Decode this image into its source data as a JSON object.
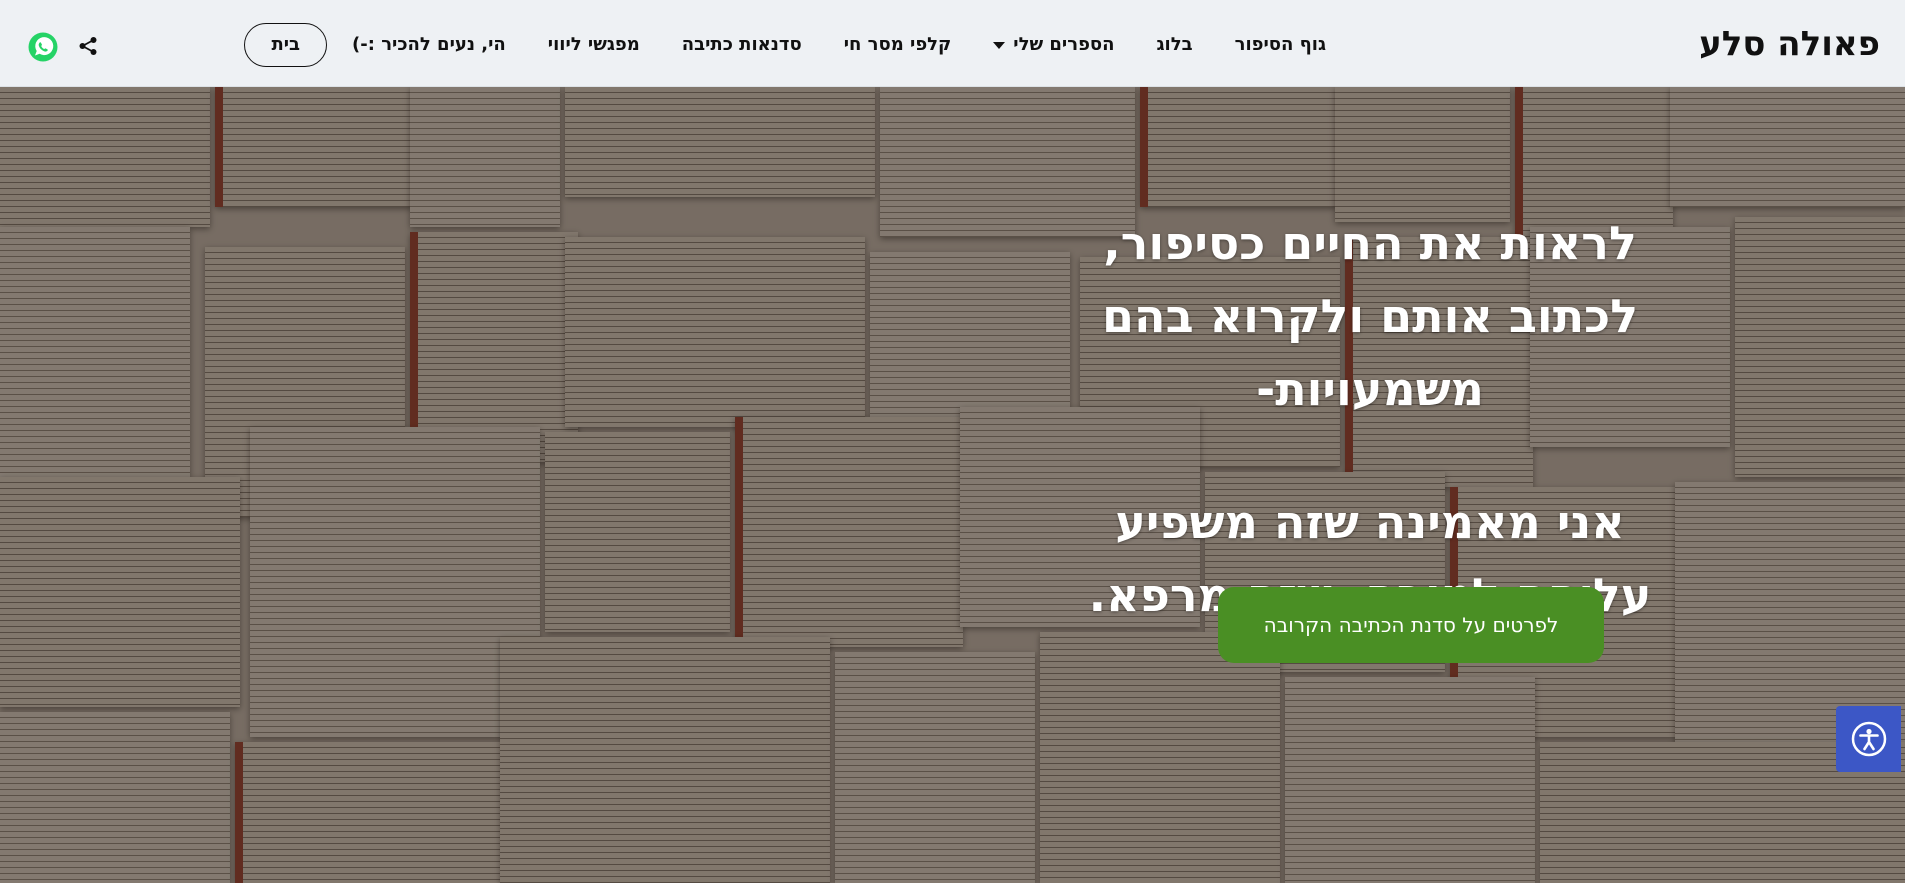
{
  "header": {
    "logo": "פאולה סלע",
    "nav": [
      {
        "label": "בית",
        "active": true
      },
      {
        "label": "הי, נעים להכיר :-)"
      },
      {
        "label": "מפגשי ליווי"
      },
      {
        "label": "סדנאות כתיבה"
      },
      {
        "label": "קלפי מסר חי"
      },
      {
        "label": "הספרים שלי",
        "has_dropdown": true
      },
      {
        "label": "בלוג"
      },
      {
        "label": "גוף הסיפור"
      }
    ],
    "icons": {
      "share": "share-icon",
      "whatsapp": "whatsapp-icon"
    },
    "whatsapp_color": "#25d366"
  },
  "hero": {
    "line1": "לראות את החיים כסיפור,",
    "line2": "לכתוב אותם ולקרוא בהם",
    "line3": "משמעויות-",
    "line4": "אני מאמינה שזה משפיע",
    "line5": "עליהם לטובה. שזה מרפא.",
    "cta_label": "לפרטים על סדנת הכתיבה הקרובה",
    "cta_color": "#4a8f24"
  },
  "accessibility": {
    "icon": "accessibility-icon",
    "color": "#3c57c6"
  }
}
